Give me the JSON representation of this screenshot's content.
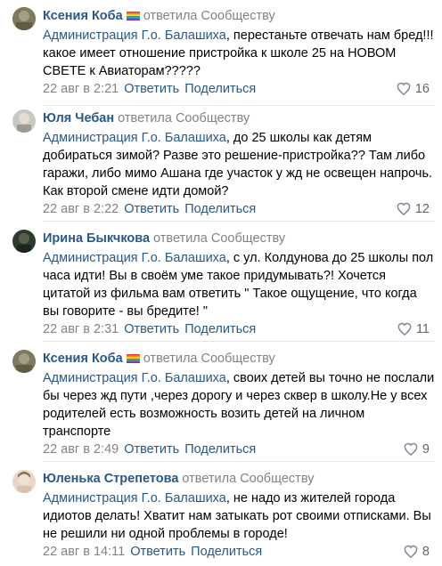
{
  "replied_label": "ответила Сообществу",
  "reply_label": "Ответить",
  "share_label": "Поделиться",
  "colors": {
    "link": "#2a5885",
    "muted": "#828282",
    "divider": "#e7e8ec"
  },
  "comments": [
    {
      "author": "Ксения Коба",
      "has_rainbow": true,
      "mention": "Администрация Г.о. Балашиха",
      "text": ", перестаньте отвечать нам бред!!!какое имеет отношение пристройка к школе 25 на НОВОМ СВЕТЕ к Авиаторам?????",
      "date": "22 авг в 2:21",
      "likes": "16"
    },
    {
      "author": "Юля Чебан",
      "has_rainbow": false,
      "mention": "Администрация Г.о. Балашиха",
      "text": ", до 25 школы как детям добираться зимой? Разве это решение-пристройка?? Там либо гаражи, либо мимо Ашана где участок у жд не освещен напрочь. Как второй смене идти домой?",
      "date": "22 авг в 2:22",
      "likes": "12"
    },
    {
      "author": "Ирина Быкчкова",
      "has_rainbow": false,
      "mention": "Администрация Г.о. Балашиха",
      "text": ", с ул. Колдунова до 25 школы пол часа идти! Вы в своём уме такое придумывать?! Хочется цитатой из фильма вам ответить \" Такое ощущение, что когда вы говорите - вы бредите! \"",
      "date": "22 авг в 2:31",
      "likes": "11"
    },
    {
      "author": "Ксения Коба",
      "has_rainbow": true,
      "mention": "Администрация Г.о. Балашиха",
      "text": ", своих детей вы точно не послали бы через жд пути ,через дорогу и через сквер в школу.Не у всех родителей есть возможность возить детей на личном транспорте",
      "date": "22 авг в 2:49",
      "likes": "9"
    },
    {
      "author": "Юленька Стрепетова",
      "has_rainbow": false,
      "mention": "Администрация Г.о. Балашиха",
      "text": ", не надо из жителей города идиотов делать! Хватит нам затыкать рот своими отписками. Вы не решили ни одной проблемы в городе!",
      "date": "22 авг в 14:11",
      "likes": "8"
    }
  ]
}
